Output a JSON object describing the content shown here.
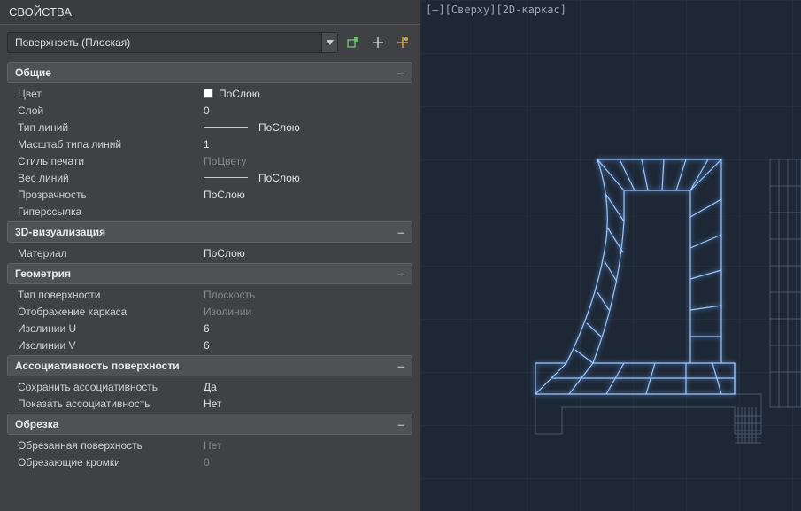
{
  "panel": {
    "title": "СВОЙСТВА",
    "selector": "Поверхность (Плоская)"
  },
  "sections": {
    "general": {
      "title": "Общие",
      "color_label": "Цвет",
      "color_value": "ПоСлою",
      "layer_label": "Слой",
      "layer_value": "0",
      "linetype_label": "Тип линий",
      "linetype_value": "ПоСлою",
      "ltscale_label": "Масштаб типа линий",
      "ltscale_value": "1",
      "plotstyle_label": "Стиль печати",
      "plotstyle_value": "ПоЦвету",
      "lineweight_label": "Вес линий",
      "lineweight_value": "ПоСлою",
      "transparency_label": "Прозрачность",
      "transparency_value": "ПоСлою",
      "hyperlink_label": "Гиперссылка",
      "hyperlink_value": ""
    },
    "visual3d": {
      "title": "3D-визуализация",
      "material_label": "Материал",
      "material_value": "ПоСлою"
    },
    "geometry": {
      "title": "Геометрия",
      "surftype_label": "Тип поверхности",
      "surftype_value": "Плоскость",
      "wireframe_label": "Отображение каркаса",
      "wireframe_value": "Изолинии",
      "isou_label": "Изолинии U",
      "isou_value": "6",
      "isov_label": "Изолинии V",
      "isov_value": "6"
    },
    "assoc": {
      "title": "Ассоциативность поверхности",
      "keep_label": "Сохранить ассоциативность",
      "keep_value": "Да",
      "show_label": "Показать ассоциативность",
      "show_value": "Нет"
    },
    "trim": {
      "title": "Обрезка",
      "trimmed_label": "Обрезанная поверхность",
      "trimmed_value": "Нет",
      "edges_label": "Обрезающие кромки",
      "edges_value": "0"
    }
  },
  "viewport": {
    "label": "[–][Сверху][2D-каркас]"
  }
}
